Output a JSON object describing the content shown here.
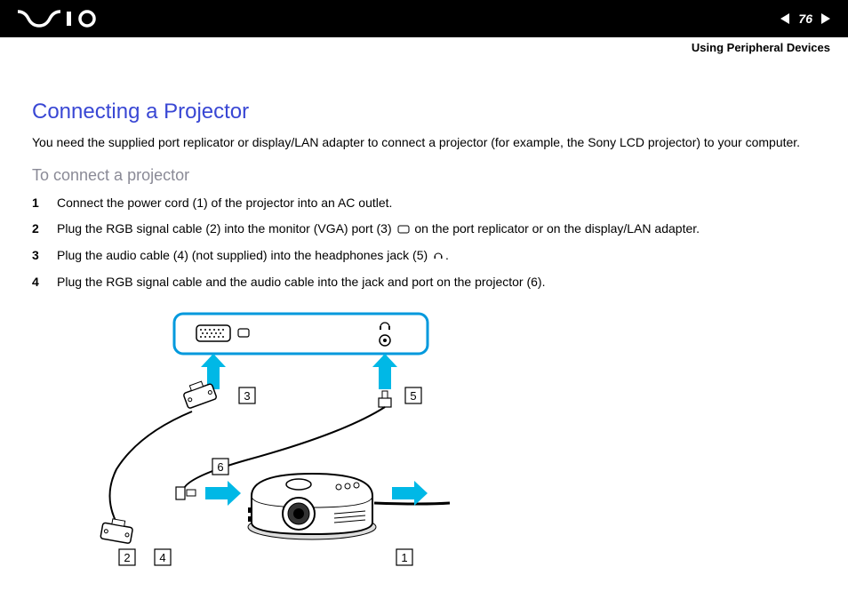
{
  "header": {
    "page_number": "76",
    "section": "Using Peripheral Devices"
  },
  "content": {
    "title": "Connecting a Projector",
    "intro": "You need the supplied port replicator or display/LAN adapter to connect a projector (for example, the Sony LCD projector) to your computer.",
    "subtitle": "To connect a projector",
    "steps": [
      {
        "num": "1",
        "text": "Connect the power cord (1) of the projector into an AC outlet."
      },
      {
        "num": "2",
        "text_before": "Plug the RGB signal cable (2) into the monitor (VGA) port (3) ",
        "text_after": " on the port replicator or on the display/LAN adapter.",
        "icon": "monitor"
      },
      {
        "num": "3",
        "text_before": "Plug the audio cable (4) (not supplied) into the headphones jack (5) ",
        "text_after": ".",
        "icon": "headphone"
      },
      {
        "num": "4",
        "text": "Plug the RGB signal cable and the audio cable into the jack and port on the projector (6)."
      }
    ]
  },
  "diagram_labels": {
    "label_1": "1",
    "label_2": "2",
    "label_3": "3",
    "label_4": "4",
    "label_5": "5",
    "label_6": "6"
  }
}
